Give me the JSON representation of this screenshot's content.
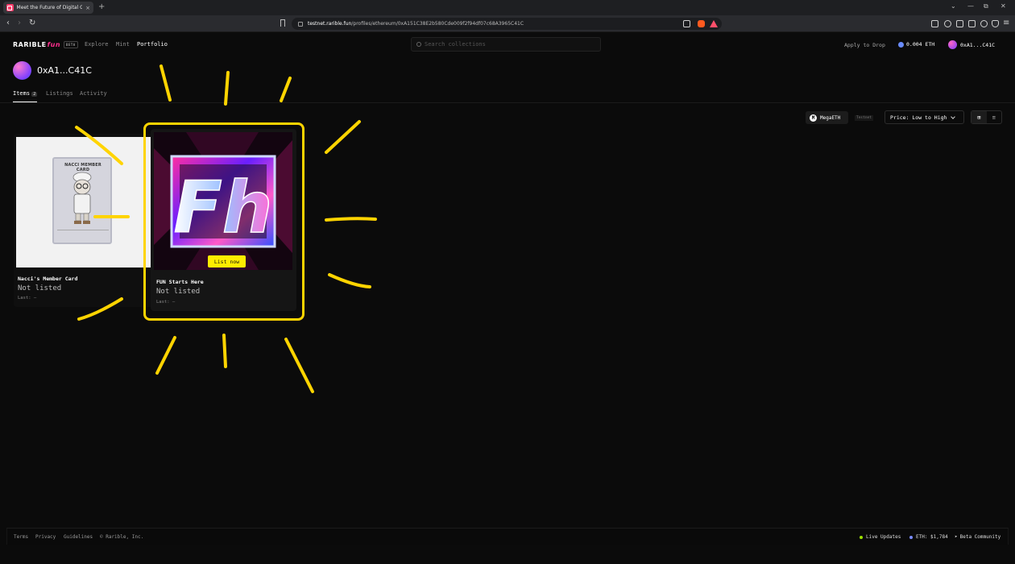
{
  "browser": {
    "tab_title": "Meet the Future of Digital Colle",
    "tab_close": "×",
    "new_tab": "+",
    "url_host": "testnet.rarible.fun",
    "url_path": "/profiles/ethereum/0xA151C38E2b580Cde009f2f94df07c68A3965C41C",
    "win_chevron": "⌄",
    "win_min": "—",
    "win_restore": "⧉",
    "win_close": "✕",
    "back": "‹",
    "forward": "›",
    "reload": "↻"
  },
  "header": {
    "logo_main": "RARIBLE",
    "logo_fun": "fun",
    "beta": "BETA",
    "nav": [
      "Explore",
      "Mint",
      "Portfolio"
    ],
    "search_placeholder": "Search collections",
    "apply": "Apply to Drop",
    "balance": "0.004 ETH",
    "account": "0xA1...C41C"
  },
  "profile": {
    "name": "0xA1...C41C",
    "tabs": [
      {
        "label": "Items",
        "count": "2"
      },
      {
        "label": "Listings"
      },
      {
        "label": "Activity"
      }
    ]
  },
  "filters": {
    "chain": "MegaETH",
    "chain_icon_letter": "M",
    "network": "Testnet",
    "sort": "Price: Low to High",
    "grid_icon": "⊞",
    "list_icon": "≡"
  },
  "items": [
    {
      "title": "Nacci's Member Card",
      "status": "Not listed",
      "last": "Last: –",
      "art_text": "NACCI MEMBER CARD"
    },
    {
      "title": "FUN Starts Here",
      "status": "Not listed",
      "last": "Last: –",
      "action": "List now",
      "art_text": "Fh"
    }
  ],
  "footer": {
    "links": [
      "Terms",
      "Privacy",
      "Guidelines",
      "© Rarible, Inc."
    ],
    "live": "Live Updates",
    "eth_price": "ETH: $1,784",
    "community": "Beta Community"
  },
  "colors": {
    "accent_yellow": "#ffec00",
    "highlight": "#ffd400",
    "brand_pink": "#ff2f8e",
    "background": "#0b0b0b"
  }
}
